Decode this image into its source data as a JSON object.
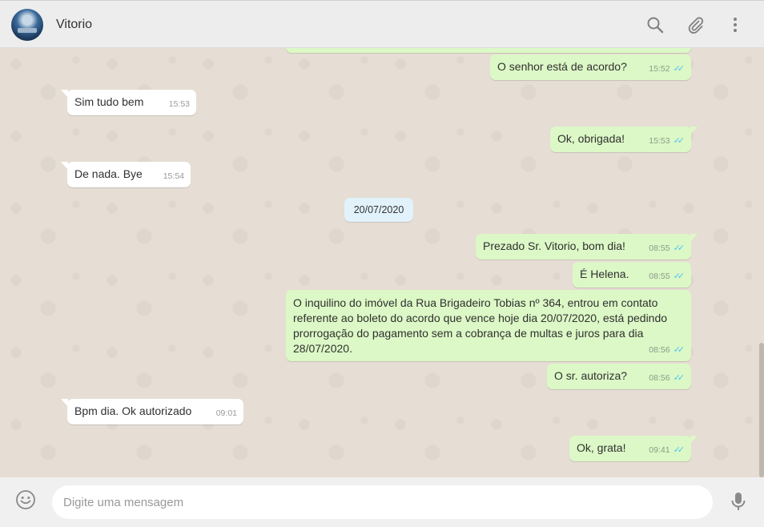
{
  "header": {
    "contact_name": "Vitorio",
    "icons": [
      "search-icon",
      "attach-icon",
      "menu-icon"
    ]
  },
  "messages": [
    {
      "direction": "out",
      "text": "O senhor está de acordo?",
      "time": "15:52",
      "status": "read"
    },
    {
      "direction": "in",
      "text": "Sim tudo bem",
      "time": "15:53"
    },
    {
      "direction": "out",
      "text": "Ok, obrigada!",
      "time": "15:53",
      "status": "read"
    },
    {
      "direction": "in",
      "text": "De nada. Bye",
      "time": "15:54"
    },
    {
      "direction": "out",
      "text": "Prezado Sr. Vitorio, bom dia!",
      "time": "08:55",
      "status": "read"
    },
    {
      "direction": "out",
      "text": "É Helena.",
      "time": "08:55",
      "status": "read"
    },
    {
      "direction": "out",
      "text": "O inquilino do imóvel da Rua Brigadeiro Tobias nº 364, entrou em contato referente ao boleto do acordo que vence hoje dia 20/07/2020, está pedindo prorrogação do pagamento sem a cobrança de multas e juros para dia 28/07/2020.",
      "time": "08:56",
      "status": "read"
    },
    {
      "direction": "out",
      "text": "O sr. autoriza?",
      "time": "08:56",
      "status": "read"
    },
    {
      "direction": "in",
      "text": "Bpm dia. Ok autorizado",
      "time": "09:01"
    },
    {
      "direction": "out",
      "text": "Ok, grata!",
      "time": "09:41",
      "status": "read"
    }
  ],
  "date_chip": "20/07/2020",
  "composer": {
    "placeholder": "Digite uma mensagem",
    "value": ""
  },
  "colors": {
    "outgoing_bubble": "#dcf8c6",
    "incoming_bubble": "#ffffff",
    "read_ticks": "#4fc3f7",
    "date_chip": "#e1f2fb"
  }
}
